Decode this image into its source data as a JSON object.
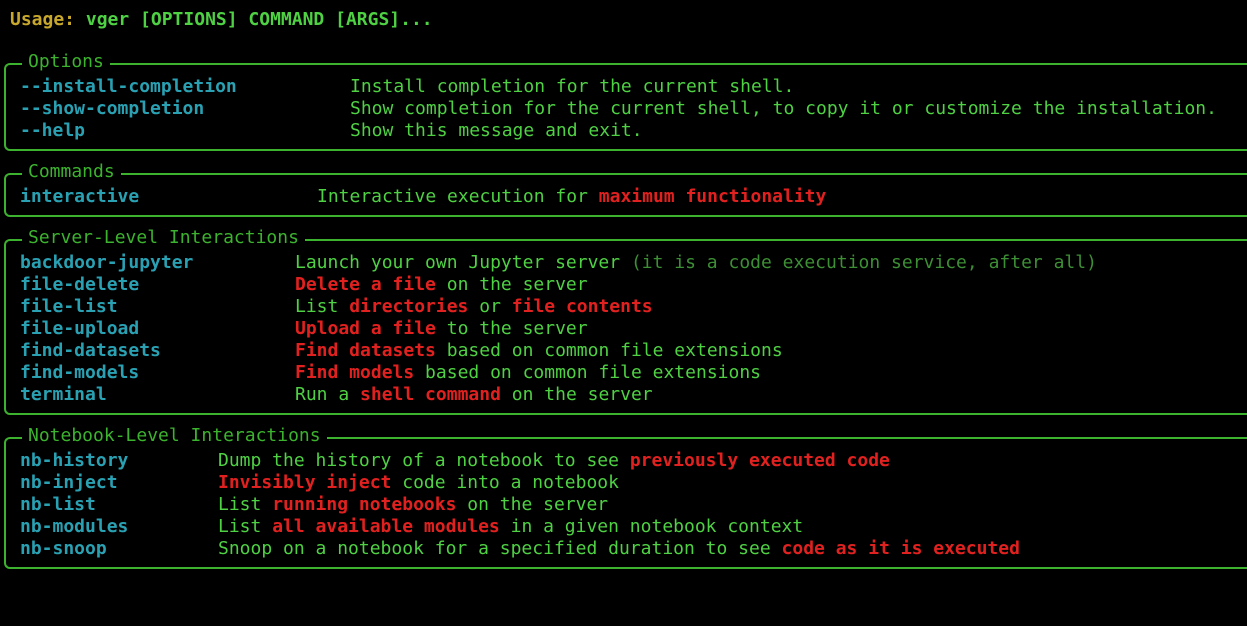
{
  "usage": {
    "label": "Usage: ",
    "text": "vger [OPTIONS] COMMAND [ARGS]..."
  },
  "colors": {
    "background": "#000000",
    "border": "#3cb32e",
    "command": "#2aa1b3",
    "description": "#4fd144",
    "highlight": "#e0211f",
    "dim": "#3d8f35",
    "usage_label": "#c8a82c"
  },
  "panels": [
    {
      "title": "Options",
      "rows": [
        {
          "name": "--install-completion",
          "parts": [
            {
              "text": "Install completion for the current shell.",
              "style": "g"
            }
          ]
        },
        {
          "name": "--show-completion",
          "parts": [
            {
              "text": "Show completion for the current shell, to copy it or customize the installation.",
              "style": "g"
            }
          ]
        },
        {
          "name": "--help",
          "parts": [
            {
              "text": "Show this message and exit.",
              "style": "g"
            }
          ]
        }
      ]
    },
    {
      "title": "Commands",
      "rows": [
        {
          "name": "interactive",
          "parts": [
            {
              "text": "Interactive execution for ",
              "style": "g"
            },
            {
              "text": "maximum functionality",
              "style": "r"
            }
          ]
        }
      ]
    },
    {
      "title": "Server-Level Interactions",
      "rows": [
        {
          "name": "backdoor-jupyter",
          "parts": [
            {
              "text": "Launch your own Jupyter server ",
              "style": "g"
            },
            {
              "text": "(it is a code execution service, after all)",
              "style": "d"
            }
          ]
        },
        {
          "name": "file-delete",
          "parts": [
            {
              "text": "Delete a file",
              "style": "r"
            },
            {
              "text": " on the server",
              "style": "g"
            }
          ]
        },
        {
          "name": "file-list",
          "parts": [
            {
              "text": "List ",
              "style": "g"
            },
            {
              "text": "directories",
              "style": "r"
            },
            {
              "text": " or ",
              "style": "g"
            },
            {
              "text": "file contents",
              "style": "r"
            }
          ]
        },
        {
          "name": "file-upload",
          "parts": [
            {
              "text": "Upload a file",
              "style": "r"
            },
            {
              "text": " to the server",
              "style": "g"
            }
          ]
        },
        {
          "name": "find-datasets",
          "parts": [
            {
              "text": "Find datasets",
              "style": "r"
            },
            {
              "text": " based on common file extensions",
              "style": "g"
            }
          ]
        },
        {
          "name": "find-models",
          "parts": [
            {
              "text": "Find models",
              "style": "r"
            },
            {
              "text": " based on common file extensions",
              "style": "g"
            }
          ]
        },
        {
          "name": "terminal",
          "parts": [
            {
              "text": "Run a ",
              "style": "g"
            },
            {
              "text": "shell command",
              "style": "r"
            },
            {
              "text": " on the server",
              "style": "g"
            }
          ]
        }
      ]
    },
    {
      "title": "Notebook-Level Interactions",
      "rows": [
        {
          "name": "nb-history",
          "parts": [
            {
              "text": "Dump the history of a notebook to see ",
              "style": "g"
            },
            {
              "text": "previously executed code",
              "style": "r"
            }
          ]
        },
        {
          "name": "nb-inject",
          "parts": [
            {
              "text": "Invisibly inject",
              "style": "r"
            },
            {
              "text": " code into a notebook",
              "style": "g"
            }
          ]
        },
        {
          "name": "nb-list",
          "parts": [
            {
              "text": "List ",
              "style": "g"
            },
            {
              "text": "running notebooks",
              "style": "r"
            },
            {
              "text": " on the server",
              "style": "g"
            }
          ]
        },
        {
          "name": "nb-modules",
          "parts": [
            {
              "text": "List ",
              "style": "g"
            },
            {
              "text": "all available modules",
              "style": "r"
            },
            {
              "text": " in a given notebook context",
              "style": "g"
            }
          ]
        },
        {
          "name": "nb-snoop",
          "parts": [
            {
              "text": "Snoop on a notebook for a specified duration to see ",
              "style": "g"
            },
            {
              "text": "code as it is executed",
              "style": "r"
            }
          ]
        }
      ]
    }
  ]
}
